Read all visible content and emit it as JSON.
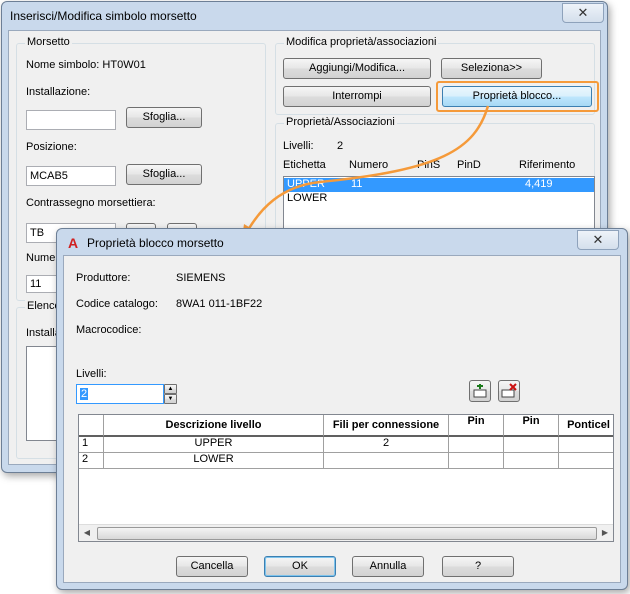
{
  "back_dialog": {
    "title": "Inserisci/Modifica simbolo morsetto",
    "close_glyph": "✕",
    "morsetto_group": "Morsetto",
    "nome_simbolo": "Nome simbolo: HT0W01",
    "installazione_label": "Installazione:",
    "installazione_value": "",
    "sfoglia_label": "Sfoglia...",
    "posizione_label": "Posizione:",
    "posizione_value": "MCAB5",
    "contrassegno_label": "Contrassegno morsettiera:",
    "contrassegno_value": "TB",
    "numero_label_partial": "Numer",
    "numero_value": "11",
    "elenco_partial": "Elenco",
    "install_partial": "Installa",
    "modifica_group": "Modifica proprietà/associazioni",
    "aggiungi_label": "Aggiungi/Modifica...",
    "seleziona_label": "Seleziona>>",
    "interrompi_label": "Interrompi",
    "proprieta_blocco_label": "Proprietà blocco...",
    "assoc_group": "Proprietà/Associazioni",
    "livelli_label": "Livelli:",
    "livelli_value": "2",
    "columns": [
      "Etichetta",
      "Numero",
      "PinS",
      "PinD",
      "Riferimento"
    ],
    "rows": [
      {
        "etichetta": "UPPER",
        "numero": "11",
        "pins": "",
        "pind": "",
        "riferimento": "4,419"
      },
      {
        "etichetta": "LOWER",
        "numero": "",
        "pins": "",
        "pind": "",
        "riferimento": ""
      }
    ]
  },
  "front_dialog": {
    "title": "Proprietà blocco morsetto",
    "app_icon_letter": "A",
    "close_glyph": "✕",
    "produttore_label": "Produttore:",
    "produttore_value": "SIEMENS",
    "codice_label": "Codice catalogo:",
    "codice_value": "8WA1 011-1BF22",
    "macrocodice_label": "Macrocodice:",
    "livelli_label": "Livelli:",
    "livelli_value": "2",
    "grid_headers": [
      "Descrizione livello",
      "Fili per connessione",
      "Pin",
      "Pin",
      "Ponticel"
    ],
    "grid_rows": [
      {
        "num": "1",
        "descrizione": "UPPER",
        "fili": "2"
      },
      {
        "num": "2",
        "descrizione": "LOWER",
        "fili": ""
      }
    ],
    "cancella_label": "Cancella",
    "ok_label": "OK",
    "annulla_label": "Annulla",
    "help_label": "?"
  },
  "colors": {
    "highlight_orange": "#f59a3a",
    "selection_blue": "#3399ff",
    "window_frame": "#c9d9ec"
  }
}
